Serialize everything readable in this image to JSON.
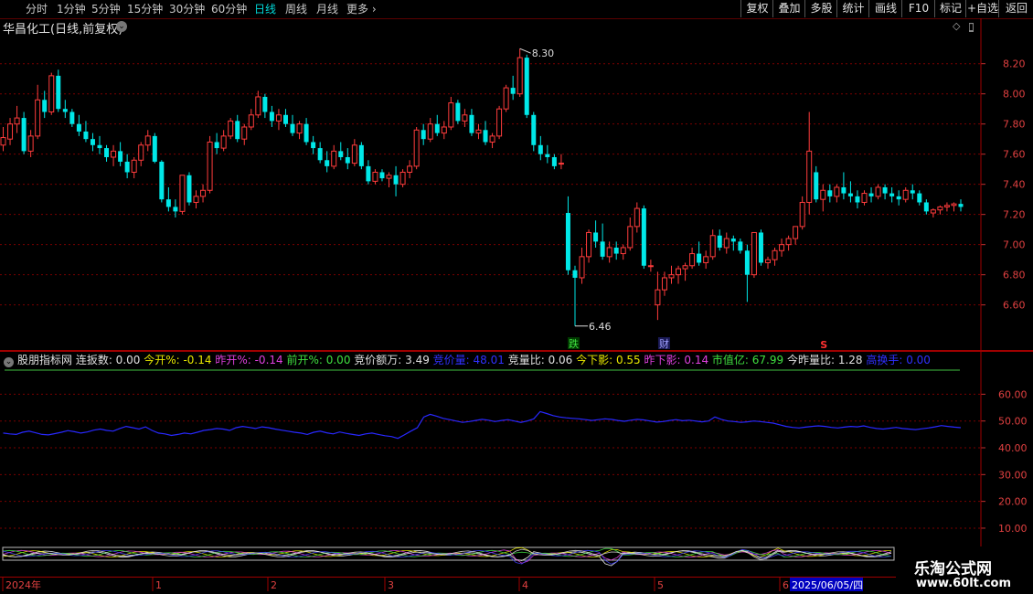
{
  "toolbar": {
    "periods": [
      "分时",
      "1分钟",
      "5分钟",
      "15分钟",
      "30分钟",
      "60分钟",
      "日线",
      "周线",
      "月线",
      "更多"
    ],
    "active_period": "日线",
    "right_buttons": [
      "复权",
      "叠加",
      "多股",
      "统计",
      "画线",
      "F10",
      "标记",
      "+自选",
      "返回"
    ]
  },
  "stock_title": "华昌化工(日线,前复权)",
  "markers": {
    "high_label": "8.30",
    "low_label": "6.46",
    "tag_die": "跌",
    "tag_cai": "财",
    "tag_s": "S"
  },
  "indicator": {
    "name": "股朋指标网",
    "items": [
      {
        "label": "连扳数:",
        "value": "0.00",
        "color": "#e0e0e0"
      },
      {
        "label": "今开%:",
        "value": "-0.14",
        "color": "#e8e800"
      },
      {
        "label": "昨开%:",
        "value": "-0.14",
        "color": "#e040e0"
      },
      {
        "label": "前开%:",
        "value": "0.00",
        "color": "#40e040"
      },
      {
        "label": "竞价额万:",
        "value": "3.49",
        "color": "#e0e0e0"
      },
      {
        "label": "竞价量:",
        "value": "48.01",
        "color": "#3030ff"
      },
      {
        "label": "竞量比:",
        "value": "0.06",
        "color": "#e0e0e0"
      },
      {
        "label": "今下影:",
        "value": "0.55",
        "color": "#e8e800"
      },
      {
        "label": "昨下影:",
        "value": "0.14",
        "color": "#e040e0"
      },
      {
        "label": "市值亿:",
        "value": "67.99",
        "color": "#40e040"
      },
      {
        "label": "今昨量比:",
        "value": "1.28",
        "color": "#e0e0e0"
      },
      {
        "label": "高换手:",
        "value": "0.00",
        "color": "#3030ff"
      }
    ]
  },
  "date_axis": {
    "labels": [
      "2024年",
      "1",
      "2",
      "3",
      "4",
      "5",
      "6"
    ],
    "cursor_date": "2025/06/05/四"
  },
  "watermark": {
    "line1": "乐淘公式网",
    "line2": "www.60lt.com"
  },
  "colors": {
    "up": "#ff3c3c",
    "down": "#00e8e8",
    "axis": "#8b0000",
    "grid": "#7a0000",
    "indicator_line": "#2828ff"
  },
  "chart_data": [
    {
      "type": "candlestick",
      "y_axis_ticks": [
        8.2,
        8.0,
        7.8,
        7.6,
        7.4,
        7.2,
        7.0,
        6.8,
        6.6
      ],
      "ylim": [
        6.41,
        8.38
      ],
      "grid": true,
      "high": 8.3,
      "low": 6.46,
      "candles": [
        [
          7.66,
          7.78,
          7.62,
          7.71
        ],
        [
          7.7,
          7.84,
          7.66,
          7.8
        ],
        [
          7.8,
          7.92,
          7.74,
          7.84
        ],
        [
          7.84,
          7.88,
          7.6,
          7.62
        ],
        [
          7.62,
          7.76,
          7.58,
          7.72
        ],
        [
          7.72,
          8.06,
          7.7,
          7.96
        ],
        [
          7.96,
          8.02,
          7.84,
          7.88
        ],
        [
          7.88,
          8.14,
          7.86,
          8.12
        ],
        [
          8.12,
          8.16,
          7.88,
          7.9
        ],
        [
          7.9,
          7.96,
          7.84,
          7.88
        ],
        [
          7.88,
          7.9,
          7.78,
          7.8
        ],
        [
          7.8,
          7.86,
          7.72,
          7.75
        ],
        [
          7.75,
          7.82,
          7.68,
          7.7
        ],
        [
          7.7,
          7.74,
          7.62,
          7.66
        ],
        [
          7.66,
          7.72,
          7.6,
          7.64
        ],
        [
          7.64,
          7.66,
          7.55,
          7.58
        ],
        [
          7.58,
          7.66,
          7.52,
          7.62
        ],
        [
          7.62,
          7.68,
          7.52,
          7.55
        ],
        [
          7.55,
          7.6,
          7.44,
          7.48
        ],
        [
          7.48,
          7.58,
          7.44,
          7.56
        ],
        [
          7.56,
          7.68,
          7.52,
          7.66
        ],
        [
          7.66,
          7.76,
          7.62,
          7.72
        ],
        [
          7.72,
          7.74,
          7.54,
          7.55
        ],
        [
          7.55,
          7.56,
          7.28,
          7.3
        ],
        [
          7.3,
          7.38,
          7.22,
          7.25
        ],
        [
          7.25,
          7.3,
          7.18,
          7.22
        ],
        [
          7.22,
          7.46,
          7.2,
          7.46
        ],
        [
          7.46,
          7.48,
          7.26,
          7.28
        ],
        [
          7.28,
          7.36,
          7.24,
          7.32
        ],
        [
          7.32,
          7.4,
          7.28,
          7.36
        ],
        [
          7.36,
          7.72,
          7.34,
          7.68
        ],
        [
          7.68,
          7.74,
          7.6,
          7.64
        ],
        [
          7.64,
          7.76,
          7.62,
          7.72
        ],
        [
          7.72,
          7.84,
          7.7,
          7.82
        ],
        [
          7.82,
          7.86,
          7.68,
          7.7
        ],
        [
          7.7,
          7.8,
          7.66,
          7.78
        ],
        [
          7.78,
          7.9,
          7.76,
          7.86
        ],
        [
          7.86,
          8.02,
          7.84,
          7.98
        ],
        [
          7.98,
          8.0,
          7.84,
          7.88
        ],
        [
          7.88,
          7.92,
          7.78,
          7.82
        ],
        [
          7.82,
          7.9,
          7.76,
          7.86
        ],
        [
          7.86,
          7.9,
          7.78,
          7.8
        ],
        [
          7.8,
          7.86,
          7.72,
          7.74
        ],
        [
          7.74,
          7.82,
          7.7,
          7.8
        ],
        [
          7.8,
          7.84,
          7.66,
          7.68
        ],
        [
          7.68,
          7.72,
          7.6,
          7.64
        ],
        [
          7.64,
          7.68,
          7.54,
          7.56
        ],
        [
          7.56,
          7.62,
          7.48,
          7.52
        ],
        [
          7.52,
          7.66,
          7.5,
          7.62
        ],
        [
          7.62,
          7.68,
          7.56,
          7.58
        ],
        [
          7.58,
          7.64,
          7.5,
          7.54
        ],
        [
          7.54,
          7.7,
          7.52,
          7.66
        ],
        [
          7.66,
          7.68,
          7.5,
          7.52
        ],
        [
          7.52,
          7.56,
          7.4,
          7.42
        ],
        [
          7.42,
          7.5,
          7.4,
          7.48
        ],
        [
          7.48,
          7.5,
          7.42,
          7.44
        ],
        [
          7.44,
          7.48,
          7.38,
          7.46
        ],
        [
          7.46,
          7.52,
          7.32,
          7.4
        ],
        [
          7.4,
          7.5,
          7.38,
          7.48
        ],
        [
          7.48,
          7.56,
          7.44,
          7.52
        ],
        [
          7.52,
          7.78,
          7.5,
          7.76
        ],
        [
          7.76,
          7.8,
          7.66,
          7.7
        ],
        [
          7.7,
          7.84,
          7.68,
          7.8
        ],
        [
          7.8,
          7.86,
          7.72,
          7.74
        ],
        [
          7.74,
          7.82,
          7.7,
          7.78
        ],
        [
          7.78,
          7.98,
          7.76,
          7.94
        ],
        [
          7.94,
          7.96,
          7.8,
          7.82
        ],
        [
          7.82,
          7.9,
          7.78,
          7.86
        ],
        [
          7.86,
          7.9,
          7.72,
          7.74
        ],
        [
          7.74,
          7.8,
          7.7,
          7.76
        ],
        [
          7.76,
          7.82,
          7.66,
          7.68
        ],
        [
          7.68,
          7.74,
          7.64,
          7.72
        ],
        [
          7.72,
          7.92,
          7.7,
          7.9
        ],
        [
          7.9,
          8.06,
          7.88,
          8.04
        ],
        [
          8.04,
          8.12,
          7.96,
          8.0
        ],
        [
          8.0,
          8.3,
          7.98,
          8.24
        ],
        [
          8.24,
          8.26,
          7.84,
          7.86
        ],
        [
          7.86,
          7.88,
          7.62,
          7.66
        ],
        [
          7.66,
          7.72,
          7.56,
          7.6
        ],
        [
          7.6,
          7.66,
          7.54,
          7.58
        ],
        [
          7.58,
          7.6,
          7.5,
          7.52
        ],
        [
          7.54,
          7.6,
          7.5,
          7.54
        ],
        [
          7.21,
          7.32,
          6.8,
          6.83
        ],
        [
          6.83,
          6.86,
          6.46,
          6.78
        ],
        [
          6.78,
          6.98,
          6.74,
          6.92
        ],
        [
          6.92,
          7.1,
          6.88,
          7.08
        ],
        [
          7.08,
          7.16,
          6.98,
          7.02
        ],
        [
          7.02,
          7.14,
          6.9,
          6.92
        ],
        [
          6.92,
          7.02,
          6.88,
          6.98
        ],
        [
          6.98,
          7.02,
          6.9,
          6.94
        ],
        [
          6.94,
          7.0,
          6.9,
          6.98
        ],
        [
          6.98,
          7.18,
          6.96,
          7.12
        ],
        [
          7.12,
          7.28,
          7.08,
          7.24
        ],
        [
          7.24,
          7.26,
          6.84,
          6.86
        ],
        [
          6.86,
          6.9,
          6.82,
          6.86
        ],
        [
          6.6,
          6.82,
          6.5,
          6.7
        ],
        [
          6.7,
          6.82,
          6.66,
          6.78
        ],
        [
          6.78,
          6.86,
          6.74,
          6.8
        ],
        [
          6.8,
          6.86,
          6.74,
          6.84
        ],
        [
          6.84,
          6.88,
          6.76,
          6.86
        ],
        [
          6.86,
          6.98,
          6.84,
          6.94
        ],
        [
          6.94,
          7.02,
          6.86,
          6.88
        ],
        [
          6.88,
          6.96,
          6.84,
          6.92
        ],
        [
          6.92,
          7.1,
          6.9,
          7.06
        ],
        [
          7.06,
          7.1,
          6.96,
          6.98
        ],
        [
          6.98,
          7.08,
          6.94,
          7.04
        ],
        [
          7.04,
          7.06,
          6.96,
          7.02
        ],
        [
          7.02,
          7.04,
          6.94,
          6.96
        ],
        [
          6.96,
          7.0,
          6.62,
          6.8
        ],
        [
          6.8,
          7.08,
          6.78,
          7.08
        ],
        [
          7.08,
          7.1,
          6.86,
          6.88
        ],
        [
          6.88,
          6.92,
          6.84,
          6.9
        ],
        [
          6.9,
          6.98,
          6.86,
          6.96
        ],
        [
          6.96,
          7.04,
          6.92,
          7.0
        ],
        [
          7.0,
          7.06,
          6.96,
          7.04
        ],
        [
          7.04,
          7.12,
          7.0,
          7.12
        ],
        [
          7.12,
          7.32,
          7.1,
          7.28
        ],
        [
          7.28,
          7.88,
          7.2,
          7.62
        ],
        [
          7.48,
          7.52,
          7.28,
          7.3
        ],
        [
          7.3,
          7.4,
          7.22,
          7.36
        ],
        [
          7.36,
          7.4,
          7.28,
          7.32
        ],
        [
          7.32,
          7.4,
          7.28,
          7.38
        ],
        [
          7.38,
          7.48,
          7.3,
          7.34
        ],
        [
          7.34,
          7.42,
          7.28,
          7.32
        ],
        [
          7.32,
          7.36,
          7.24,
          7.28
        ],
        [
          7.28,
          7.36,
          7.26,
          7.34
        ],
        [
          7.34,
          7.38,
          7.28,
          7.32
        ],
        [
          7.32,
          7.4,
          7.3,
          7.38
        ],
        [
          7.38,
          7.4,
          7.3,
          7.34
        ],
        [
          7.34,
          7.38,
          7.28,
          7.32
        ],
        [
          7.32,
          7.36,
          7.26,
          7.3
        ],
        [
          7.3,
          7.38,
          7.28,
          7.36
        ],
        [
          7.36,
          7.4,
          7.3,
          7.34
        ],
        [
          7.34,
          7.36,
          7.26,
          7.28
        ],
        [
          7.28,
          7.3,
          7.2,
          7.22
        ],
        [
          7.21,
          7.24,
          7.18,
          7.23
        ],
        [
          7.23,
          7.26,
          7.2,
          7.25
        ],
        [
          7.25,
          7.28,
          7.22,
          7.26
        ],
        [
          7.26,
          7.28,
          7.22,
          7.27
        ],
        [
          7.27,
          7.3,
          7.22,
          7.25
        ]
      ]
    },
    {
      "type": "line",
      "y_axis_ticks": [
        60.0,
        50.0,
        40.0,
        30.0,
        20.0,
        10.0
      ],
      "ylim": [
        3.5,
        69
      ],
      "grid": true,
      "series": [
        {
          "values": [
            45.5,
            45.2,
            45.0,
            45.8,
            46.2,
            45.6,
            45.0,
            44.8,
            45.3,
            45.8,
            46.4,
            46.0,
            45.5,
            45.9,
            46.6,
            47.0,
            46.5,
            46.2,
            47.2,
            48.0,
            47.5,
            47.0,
            47.8,
            46.5,
            45.5,
            45.2,
            44.6,
            45.0,
            45.5,
            45.2,
            45.8,
            46.5,
            46.8,
            47.2,
            47.0,
            46.5,
            47.5,
            48.0,
            47.6,
            47.2,
            47.8,
            47.5,
            47.0,
            46.6,
            46.2,
            45.8,
            45.5,
            45.0,
            45.8,
            46.2,
            45.6,
            45.2,
            45.9,
            45.4,
            45.0,
            44.6,
            45.2,
            45.5,
            45.0,
            44.5,
            44.2,
            43.5,
            44.8,
            46.2,
            47.5,
            51.5,
            52.5,
            51.8,
            51.0,
            50.5,
            50.0,
            49.5,
            49.8,
            50.2,
            50.6,
            50.3,
            49.8,
            50.2,
            50.5,
            50.0,
            49.5,
            50.0,
            50.8,
            53.5,
            52.8,
            52.0,
            51.5,
            51.2,
            51.0,
            50.8,
            50.5,
            50.2,
            50.5,
            50.8,
            50.6,
            50.2,
            49.9,
            50.3,
            50.6,
            50.4,
            50.0,
            49.6,
            49.8,
            50.2,
            50.5,
            50.1,
            50.3,
            50.0,
            49.7,
            50.0,
            51.5,
            50.6,
            50.0,
            49.8,
            49.5,
            49.7,
            50.0,
            49.8,
            49.5,
            49.2,
            48.6,
            48.0,
            47.6,
            47.4,
            47.7,
            48.0,
            48.2,
            48.0,
            47.6,
            47.4,
            47.7,
            48.0,
            47.8,
            48.2,
            47.6,
            47.2,
            47.0,
            47.3,
            47.6,
            47.2,
            47.0,
            46.8,
            47.1,
            47.4,
            47.8,
            48.3,
            48.0,
            47.7,
            47.5
          ]
        }
      ]
    }
  ]
}
